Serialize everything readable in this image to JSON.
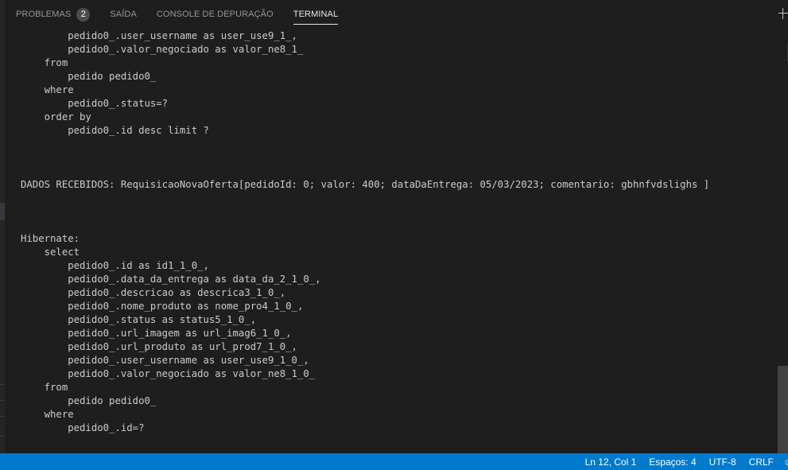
{
  "panel": {
    "tabs": [
      {
        "label": "PROBLEMAS",
        "badge": "2",
        "active": false
      },
      {
        "label": "SAÍDA",
        "active": false
      },
      {
        "label": "CONSOLE DE DEPURAÇÃO",
        "active": false
      },
      {
        "label": "TERMINAL",
        "active": true
      }
    ],
    "new_terminal_icon": "plus-icon"
  },
  "terminal": {
    "lines": [
      "        pedido0_.user_username as user_use9_1_,",
      "        pedido0_.valor_negociado as valor_ne8_1_",
      "    from",
      "        pedido pedido0_",
      "    where",
      "        pedido0_.status=?",
      "    order by",
      "        pedido0_.id desc limit ?",
      "",
      "",
      "",
      "DADOS RECEBIDOS: RequisicaoNovaOferta[pedidoId: 0; valor: 400; dataDaEntrega: 05/03/2023; comentario: gbhnfvdslighs ]",
      "",
      "",
      "",
      "Hibernate:",
      "    select",
      "        pedido0_.id as id1_1_0_,",
      "        pedido0_.data_da_entrega as data_da_2_1_0_,",
      "        pedido0_.descricao as descrica3_1_0_,",
      "        pedido0_.nome_produto as nome_pro4_1_0_,",
      "        pedido0_.status as status5_1_0_,",
      "        pedido0_.url_imagem as url_imag6_1_0_,",
      "        pedido0_.url_produto as url_prod7_1_0_,",
      "        pedido0_.user_username as user_use9_1_0_,",
      "        pedido0_.valor_negociado as valor_ne8_1_0_",
      "    from",
      "        pedido pedido0_",
      "    where",
      "        pedido0_.id=?"
    ]
  },
  "statusbar": {
    "position": "Ln 12, Col 1",
    "indentation": "Espaços: 4",
    "encoding": "UTF-8",
    "line_ending": "CRLF",
    "feedback_icon": "smiley-icon"
  }
}
